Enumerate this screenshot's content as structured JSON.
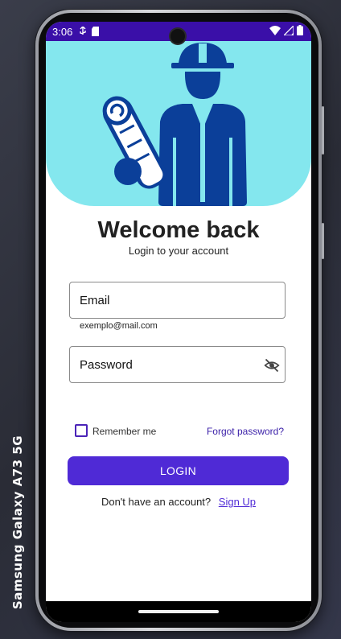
{
  "device": {
    "label": "Samsung Galaxy  A73 5G"
  },
  "status_bar": {
    "time": "3:06"
  },
  "header": {
    "title": "Welcome back",
    "subtitle": "Login to your account"
  },
  "form": {
    "email_label": "Email",
    "email_helper": "exemplo@mail.com",
    "password_label": "Password",
    "remember_label": "Remember me",
    "remember_checked": false,
    "forgot_label": "Forgot password?",
    "login_label": "LOGIN"
  },
  "footer": {
    "prompt": "Don't have an account?",
    "signup_label": "Sign Up"
  },
  "colors": {
    "status_bar": "#3a0fa8",
    "hero_bg": "#84e7ee",
    "illustration": "#0b3f99",
    "primary": "#4f2ad6"
  },
  "icons": {
    "hero": "engineer-with-blueprint-icon",
    "password_toggle": "eye-off-icon",
    "wifi": "wifi-icon",
    "signal": "signal-icon",
    "battery": "battery-icon"
  }
}
